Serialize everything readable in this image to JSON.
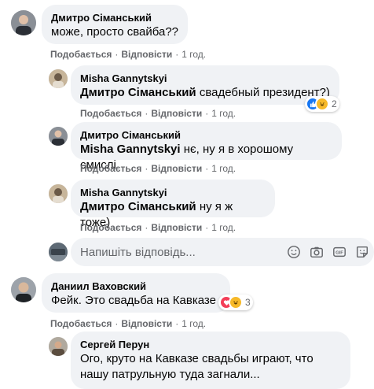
{
  "comments": [
    {
      "author": "Дмитро Сіманський",
      "text": "може, просто свайба??",
      "like_label": "Подобається",
      "reply_label": "Відповісти",
      "time": "1 год."
    },
    {
      "author": "Misha Gannytskyi",
      "mention": "Дмитро Сіманський",
      "text": " свадебный президент?)",
      "like_label": "Подобається",
      "reply_label": "Відповісти",
      "time": "1 год.",
      "reaction_count": "2"
    },
    {
      "author": "Дмитро Сіманський",
      "mention": "Misha Gannytskyi",
      "text": " нє, ну я в хорошому смислі",
      "like_label": "Подобається",
      "reply_label": "Відповісти",
      "time": "1 год."
    },
    {
      "author": "Misha Gannytskyi",
      "mention": "Дмитро Сіманський",
      "text": " ну я ж тоже)",
      "like_label": "Подобається",
      "reply_label": "Відповісти",
      "time": "1 год."
    },
    {
      "author": "Даниил Ваховский",
      "text": "Фейк. Это свадьба на Кавказе",
      "like_label": "Подобається",
      "reply_label": "Відповісти",
      "time": "1 год.",
      "reaction_count": "3"
    },
    {
      "author": "Сергей Перун",
      "text": "Ого, круто на Кавказе свадьбы играют, что нашу патрульную туда загнали..."
    }
  ],
  "reply_input": {
    "placeholder": "Напишіть відповідь..."
  },
  "icons": {
    "emoji": "smiley-icon",
    "camera": "camera-icon",
    "gif": "gif-icon",
    "sticker": "sticker-icon",
    "gif_text": "GIF"
  },
  "colors": {
    "like_blue": "#1877f2",
    "haha_yellow": "#f7b928",
    "love_red": "#f33e58",
    "bubble_bg": "#f0f2f5",
    "meta_gray": "#65676b"
  }
}
